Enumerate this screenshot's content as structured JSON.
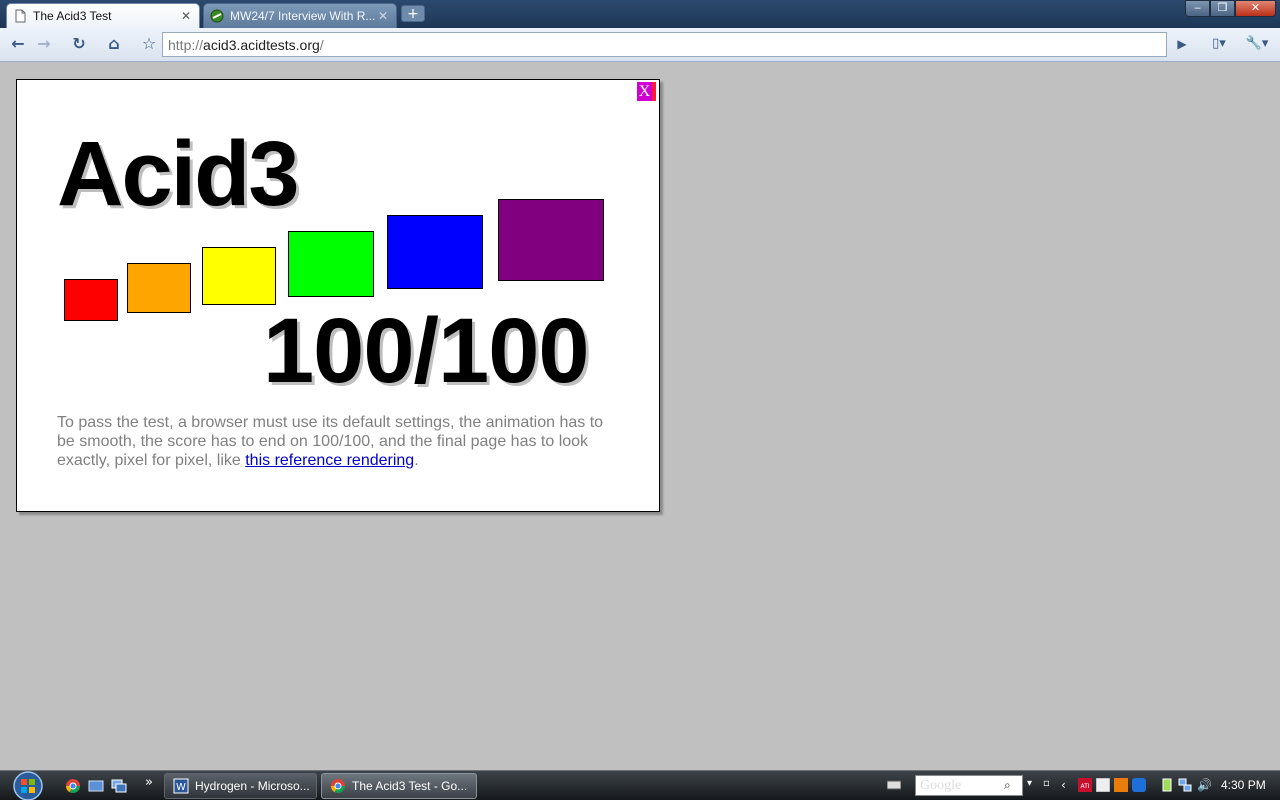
{
  "browser": {
    "tabs": [
      {
        "title": "The Acid3 Test",
        "active": true
      },
      {
        "title": "MW24/7 Interview With R...",
        "active": false
      }
    ],
    "new_tab": "+",
    "window_controls": {
      "minimize": "‒",
      "maximize": "❐",
      "close": "✕"
    },
    "toolbar": {
      "back": "←",
      "forward": "→",
      "reload": "↻",
      "home": "⌂",
      "star": "☆",
      "go": "▶",
      "page_menu": "▯▾",
      "tools_menu": "🔧▾"
    },
    "url": {
      "scheme": "http://",
      "host": "acid3.acidtests.org",
      "path": "/"
    }
  },
  "acid3": {
    "close_label": "X",
    "title": "Acid3",
    "score": "100/100",
    "buckets": [
      {
        "color": "#ff0000"
      },
      {
        "color": "#ffa500"
      },
      {
        "color": "#ffff00"
      },
      {
        "color": "#00ff00"
      },
      {
        "color": "#0000ff"
      },
      {
        "color": "#800080"
      }
    ],
    "description_text": "To pass the test, a browser must use its default settings, the animation has to be smooth, the score has to end on 100/100, and the final page has to look exactly, pixel for pixel, like ",
    "link_text": "this reference rendering",
    "description_end": "."
  },
  "taskbar": {
    "quicklaunch_more": "»",
    "tasks": [
      {
        "label": "Hydrogen - Microso...",
        "active": false
      },
      {
        "label": "The Acid3 Test - Go...",
        "active": true
      }
    ],
    "search_placeholder": "Google",
    "clock": "4:30 PM"
  },
  "colors": {
    "page_bg": "#c0c0c0",
    "link": "#0000cc",
    "desc_text": "#808080"
  }
}
